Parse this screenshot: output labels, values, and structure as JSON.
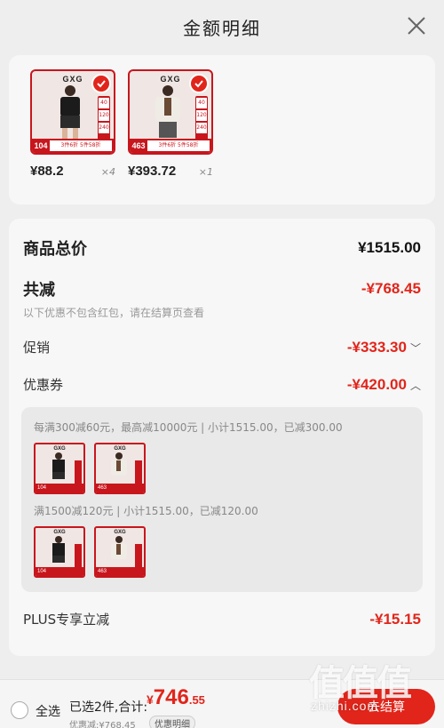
{
  "header": {
    "title": "金额明细"
  },
  "products": [
    {
      "brand": "GXG",
      "badge_num": "104",
      "promo": "3件6折 5件58折",
      "price": "¥88.2",
      "qty": "×4"
    },
    {
      "brand": "GXG",
      "badge_num": "463",
      "promo": "3件6折 5件58折",
      "price": "¥393.72",
      "qty": "×1"
    }
  ],
  "summary": {
    "goods_total_label": "商品总价",
    "goods_total_value": "¥1515.00",
    "total_discount_label": "共减",
    "total_discount_value": "-¥768.45",
    "note": "以下优惠不包含红包，请在结算页查看",
    "promo_label": "促销",
    "promo_value": "-¥333.30",
    "coupon_label": "优惠券",
    "coupon_value": "-¥420.00",
    "plus_label": "PLUS专享立减",
    "plus_value": "-¥15.15"
  },
  "coupons": [
    {
      "text": "每满300减60元，最高减10000元 | 小计1515.00，已减300.00",
      "items": [
        {
          "brand": "GXG",
          "badge_num": "104"
        },
        {
          "brand": "GXG",
          "badge_num": "463"
        }
      ]
    },
    {
      "text": "满1500减120元 | 小计1515.00，已减120.00",
      "items": [
        {
          "brand": "GXG",
          "badge_num": "104"
        },
        {
          "brand": "GXG",
          "badge_num": "463"
        }
      ]
    }
  ],
  "bottom": {
    "select_all": "全选",
    "selected_info": "已选2件,合计:",
    "total_yen": "¥",
    "total_integer": "746",
    "total_decimal": ".55",
    "discount_text": "优惠减:¥768.45",
    "discount_detail_btn": "优惠明细",
    "checkout_label": "去结算"
  },
  "watermark": {
    "glyphs": "值值值",
    "url": "zhizhi.com"
  },
  "colors": {
    "accent": "#e1251b",
    "brand_red": "#c8161d"
  }
}
